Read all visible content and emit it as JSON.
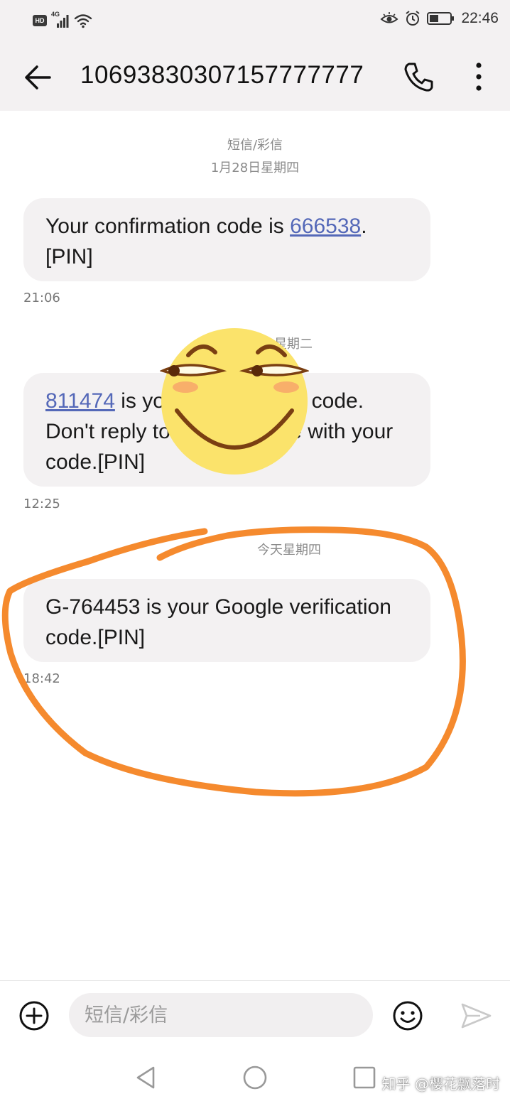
{
  "status_bar": {
    "hd_badge": "HD",
    "network": "4G",
    "time": "22:46",
    "icons": [
      "signal-icon",
      "wifi-icon",
      "eye-comfort-icon",
      "alarm-icon",
      "battery-icon"
    ]
  },
  "header": {
    "title": "10693830307157777777",
    "icons": [
      "back-arrow-icon",
      "phone-icon",
      "more-vertical-icon"
    ]
  },
  "messages": {
    "category": "短信/彩信",
    "groups": [
      {
        "date": "1月28日星期四",
        "text_before": "Your confirmation code is ",
        "code": "666538",
        "text_after": ".[PIN]",
        "time": "21:06"
      },
      {
        "date": "星期二",
        "code": "811474",
        "text_after": " is your confirmation code. Don't reply to this message with your code.[PIN]",
        "time": "12:25"
      },
      {
        "date": "今天星期四",
        "text": "G-764453 is your Google verification code.[PIN]",
        "time": "18:42"
      }
    ]
  },
  "input_bar": {
    "placeholder": "短信/彩信",
    "icons": [
      "add-icon",
      "emoji-icon",
      "send-icon"
    ]
  },
  "nav_bar": {
    "icons": [
      "nav-back-icon",
      "nav-home-icon",
      "nav-recents-icon"
    ]
  },
  "watermark": "知乎 @樱花飘落时",
  "colors": {
    "header_bg": "#f3f1f2",
    "bubble_bg": "#f3f1f2",
    "link": "#5468b8",
    "annotation": "#f58a2e",
    "emoji_face": "#fbe36b"
  }
}
